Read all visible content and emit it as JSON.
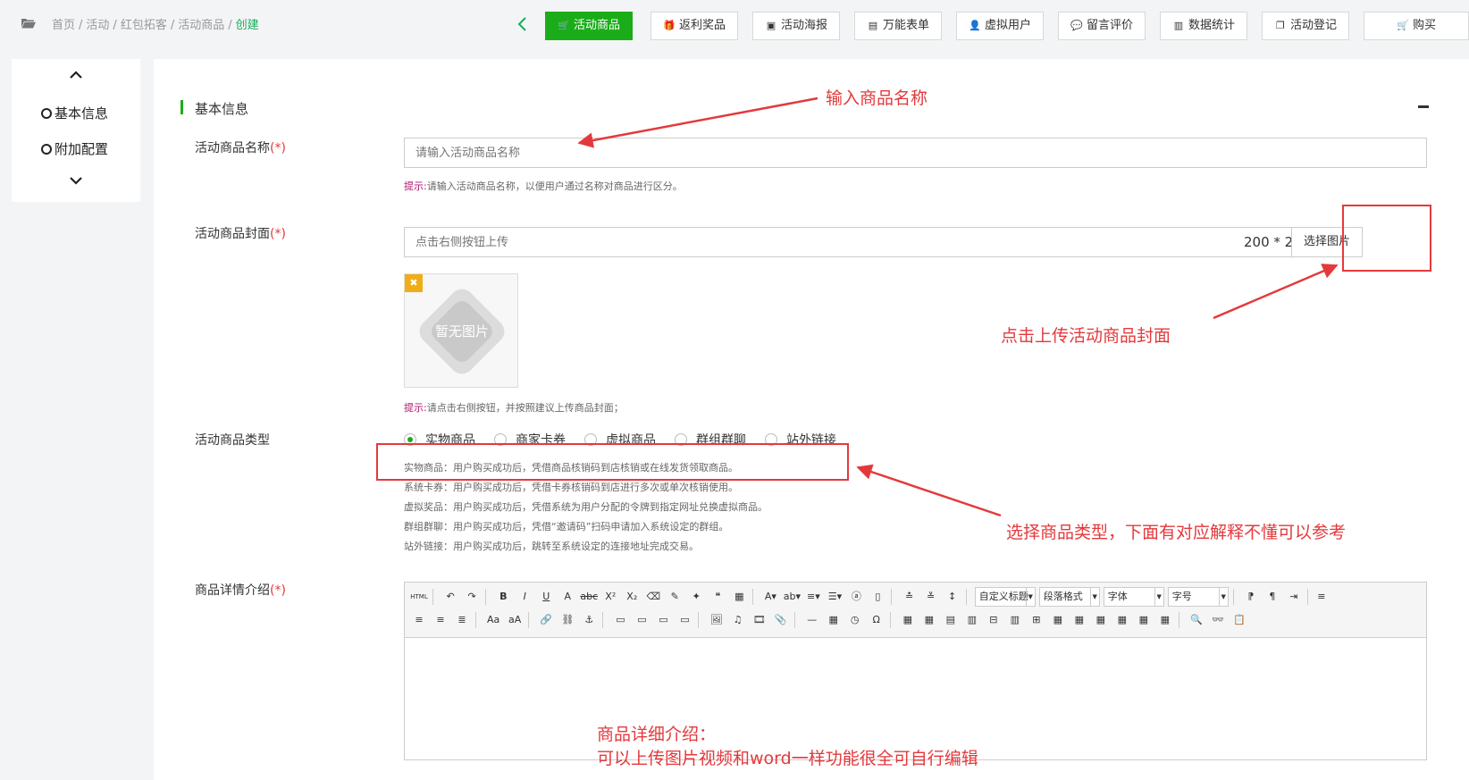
{
  "breadcrumb": {
    "items": [
      "首页",
      "活动",
      "红包拓客",
      "活动商品"
    ],
    "current": "创建"
  },
  "tabs": [
    {
      "label": "活动商品",
      "icon": "cart-icon",
      "active": true
    },
    {
      "label": "返利奖品",
      "icon": "gift-icon",
      "active": false
    },
    {
      "label": "活动海报",
      "icon": "image-icon",
      "active": false
    },
    {
      "label": "万能表单",
      "icon": "file-icon",
      "active": false
    },
    {
      "label": "虚拟用户",
      "icon": "user-plus-icon",
      "active": false
    },
    {
      "label": "留言评价",
      "icon": "comments-icon",
      "active": false
    },
    {
      "label": "数据统计",
      "icon": "bar-chart-icon",
      "active": false
    },
    {
      "label": "活动登记",
      "icon": "copy-icon",
      "active": false
    },
    {
      "label": "购买",
      "icon": "cart-icon",
      "active": false
    }
  ],
  "sidenav": {
    "items": [
      "基本信息",
      "附加配置"
    ]
  },
  "section": {
    "title": "基本信息"
  },
  "form": {
    "name": {
      "label": "活动商品名称",
      "required_mark": "(*)",
      "placeholder": "请输入活动商品名称",
      "tip_prefix": "提示:",
      "tip": "请输入活动商品名称，以便用户通过名称对商品进行区分。"
    },
    "cover": {
      "label": "活动商品封面",
      "required_mark": "(*)",
      "placeholder": "点击右侧按钮上传",
      "size_hint": "200 * 200 像素",
      "button": "选择图片",
      "no_image": "暂无图片",
      "tip_prefix": "提示:",
      "tip": "请点击右侧按钮，并按照建议上传商品封面；"
    },
    "type": {
      "label": "活动商品类型",
      "options": [
        "实物商品",
        "商家卡券",
        "虚拟商品",
        "群组群聊",
        "站外链接"
      ],
      "selected": "实物商品",
      "explanations": [
        "实物商品：用户购买成功后，凭借商品核销码到店核销或在线发货领取商品。",
        "系统卡券：用户购买成功后，凭借卡券核销码到店进行多次或单次核销使用。",
        "虚拟奖品：用户购买成功后，凭借系统为用户分配的令牌到指定网址兑换虚拟商品。",
        "群组群聊：用户购买成功后，凭借“邀请码”扫码申请加入系统设定的群组。",
        "站外链接：用户购买成功后，跳转至系统设定的连接地址完成交易。"
      ]
    },
    "detail": {
      "label": "商品详情介绍",
      "required_mark": "(*)",
      "toolbar_selects": [
        "自定义标题",
        "段落格式",
        "字体",
        "字号"
      ]
    }
  },
  "annotations": {
    "name_note": "输入商品名称",
    "cover_note": "点击上传活动商品封面",
    "type_note": "选择商品类型，下面有对应解释不懂可以参考",
    "detail_note_line1": "商品详细介绍：",
    "detail_note_line2": "可以上传图片视频和word一样功能很全可自行编辑"
  },
  "colors": {
    "accent": "#1aad19",
    "annotation_red": "#e4393c",
    "tip_magenta": "#b0166e"
  }
}
